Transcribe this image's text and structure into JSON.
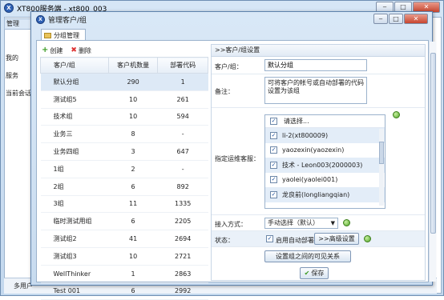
{
  "outer_window": {
    "title": "XT800服务端 - xt800_003",
    "logo_char": "X",
    "tab_label": "管理",
    "side_items": [
      "我的",
      "服务",
      "当前会话"
    ],
    "bottom_tab": "多用户"
  },
  "dialog": {
    "title": "管理客户/组",
    "logo_char": "X",
    "tab_label": "分组管理"
  },
  "toolbar": {
    "create_label": "创建",
    "delete_label": "删除"
  },
  "group_table": {
    "columns": [
      "客户/组",
      "客户机数量",
      "部署代码"
    ],
    "rows": [
      [
        "默认分组",
        "290",
        "1"
      ],
      [
        "测试组5",
        "10",
        "261"
      ],
      [
        "技术组",
        "10",
        "594"
      ],
      [
        "业务三",
        "8",
        "-"
      ],
      [
        "业务四组",
        "3",
        "647"
      ],
      [
        "1组",
        "2",
        "-"
      ],
      [
        "2组",
        "6",
        "892"
      ],
      [
        "3组",
        "11",
        "1335"
      ],
      [
        "临时测试用组",
        "6",
        "2205"
      ],
      [
        "测试组2",
        "41",
        "2694"
      ],
      [
        "测试组3",
        "10",
        "2721"
      ],
      [
        "WellThinker",
        "1",
        "2863"
      ],
      [
        "Test 001",
        "6",
        "2992"
      ]
    ],
    "selected_index": 0
  },
  "settings": {
    "header": ">>客户/组设置",
    "name_label": "客户/组：",
    "name_value": "默认分组",
    "note_label": "备注：",
    "note_value": "可将客户的帐号或自动部署的代码设置为该组",
    "agent_label": "指定运维客服：",
    "agent_header": "请选择...",
    "agents": [
      {
        "name": "li-2(xt800009)",
        "checked": true
      },
      {
        "name": "yaozexin(yaozexin)",
        "checked": true
      },
      {
        "name": "技术 - Leon003(2000003)",
        "checked": true
      },
      {
        "name": "yaolei(yaolei001)",
        "checked": true
      },
      {
        "name": "龙良前(longliangqian)",
        "checked": true
      }
    ],
    "access_label": "接入方式：",
    "access_value": "手动选择（默认）",
    "status_label": "状态：",
    "auto_deploy_label": "启用自动部署",
    "auto_deploy_checked": true,
    "advanced_button": ">>高级设置",
    "visibility_button": "设置组之间的可见关系",
    "save_button": "保存"
  },
  "window_buttons": {
    "minimize": "‒",
    "maximize": "□",
    "close": "✕"
  }
}
